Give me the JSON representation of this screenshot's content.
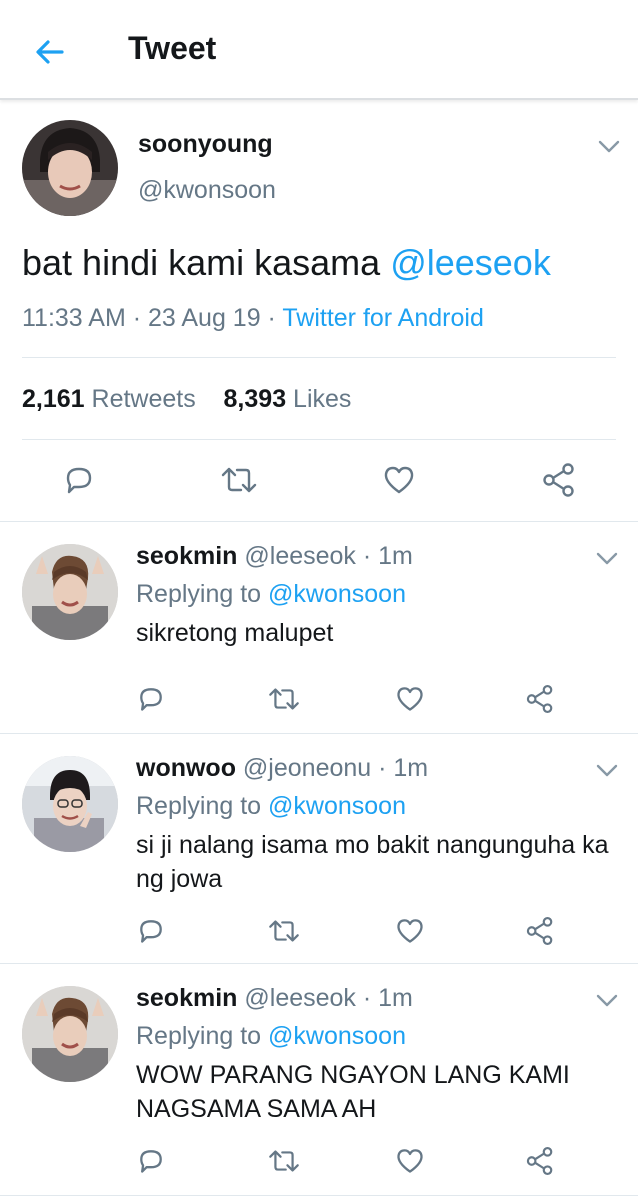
{
  "header": {
    "title": "Tweet",
    "back_icon": "arrow-left-icon"
  },
  "colors": {
    "accent": "#1da1f2",
    "secondary_text": "#657786",
    "primary_text": "#14171a"
  },
  "main_tweet": {
    "name": "soonyoung",
    "handle": "@kwonsoon",
    "text": "bat hindi kami kasama ",
    "mention": "@leeseok",
    "time": "11:33 AM · 23 Aug 19 · ",
    "source": "Twitter for Android",
    "retweets_count": "2,161",
    "retweets_label": " Retweets",
    "likes_count": "8,393",
    "likes_label": " Likes"
  },
  "replies": [
    {
      "name": "seokmin",
      "handle": " @leeseok · 1m",
      "replying_prefix": "Replying to ",
      "replying_to": "@kwonsoon",
      "text": "sikretong malupet"
    },
    {
      "name": "wonwoo",
      "handle": " @jeoneonu · 1m",
      "replying_prefix": "Replying to ",
      "replying_to": "@kwonsoon",
      "text": "si ji nalang isama mo bakit nangunguha ka ng jowa"
    },
    {
      "name": "seokmin",
      "handle": " @leeseok · 1m",
      "replying_prefix": "Replying to ",
      "replying_to": "@kwonsoon",
      "text": "WOW PARANG NGAYON LANG KAMI NAGSAMA SAMA AH"
    }
  ],
  "action_icons": [
    "reply-icon",
    "retweet-icon",
    "like-icon",
    "share-icon"
  ]
}
